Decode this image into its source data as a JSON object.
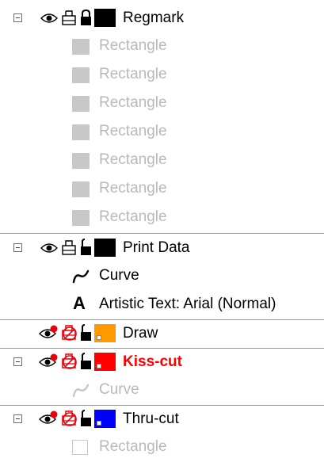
{
  "layers": {
    "regmark": {
      "name": "Regmark",
      "color": "#000000",
      "children": [
        "Rectangle",
        "Rectangle",
        "Rectangle",
        "Rectangle",
        "Rectangle",
        "Rectangle",
        "Rectangle"
      ]
    },
    "print_data": {
      "name": "Print Data",
      "color": "#000000",
      "children": [
        {
          "icon": "curve-icon",
          "label": "Curve"
        },
        {
          "icon": "artistic-text-icon",
          "label": "Artistic Text: Arial (Normal)"
        }
      ]
    },
    "draw": {
      "name": "Draw",
      "color": "#ff9900"
    },
    "kiss_cut": {
      "name": "Kiss-cut",
      "color": "#ff0000",
      "children": [
        {
          "icon": "curve-icon",
          "label": "Curve"
        }
      ]
    },
    "thru_cut": {
      "name": "Thru-cut",
      "color": "#0000ff",
      "children": [
        {
          "icon": "rectangle-outline-icon",
          "label": "Rectangle"
        }
      ]
    }
  },
  "icons": {
    "visibility": "eye-icon",
    "printable": "printer-icon",
    "lock": "lock-icon",
    "glyph_A": "A"
  }
}
